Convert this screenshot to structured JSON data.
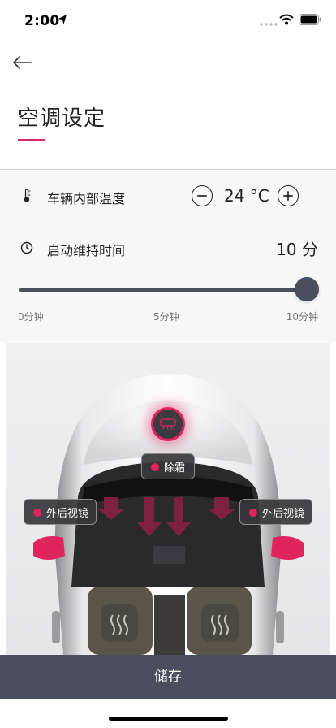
{
  "status": {
    "time": "2:00"
  },
  "header": {
    "title": "空调设定"
  },
  "settings": {
    "temperature": {
      "label": "车辆内部温度",
      "value": "24 °C"
    },
    "duration": {
      "label": "启动维持时间",
      "value": "10 分",
      "fraction": 1.0
    },
    "slider": {
      "min_label": "0分钟",
      "mid_label": "5分钟",
      "max_label": "10分钟"
    }
  },
  "car": {
    "defrost_label": "除霜",
    "mirror_left_label": "外后视镜",
    "mirror_right_label": "外后视镜"
  },
  "footer": {
    "save_label": "储存"
  },
  "colors": {
    "accent": "#e0245e",
    "bar": "#4a4f5e"
  },
  "icons": [
    "back-arrow-icon",
    "thermometer-icon",
    "clock-icon",
    "minus-icon",
    "plus-icon",
    "defrost-icon",
    "seat-heat-icon",
    "location-arrow-icon",
    "wifi-icon",
    "battery-icon"
  ]
}
